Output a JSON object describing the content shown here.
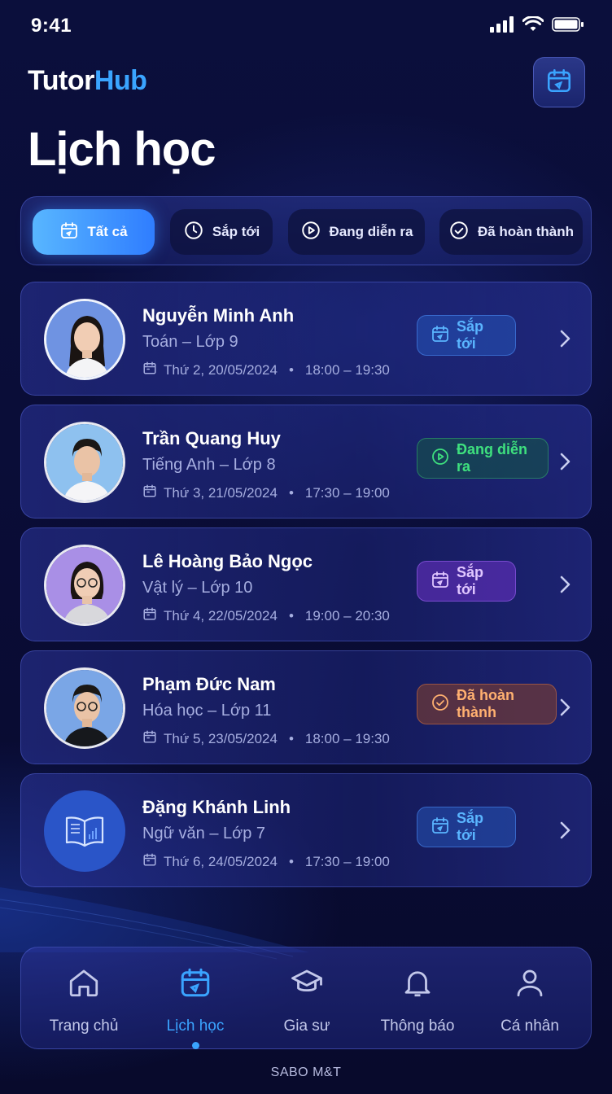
{
  "status_bar": {
    "time": "9:41"
  },
  "header": {
    "brand_part1": "Tutor",
    "brand_part2": "Hub",
    "calendar_button_icon": "calendar-icon"
  },
  "page_title": "Lịch học",
  "filters": [
    {
      "label": "Tất cả",
      "icon": "calendar-icon",
      "active": true
    },
    {
      "label": "Sắp tới",
      "icon": "clock-icon",
      "active": false
    },
    {
      "label": "Đang diễn ra",
      "icon": "play-circle-icon",
      "active": false
    },
    {
      "label": "Đã hoàn thành",
      "icon": "check-circle-icon",
      "active": false
    }
  ],
  "lessons": [
    {
      "name": "Nguyễn Minh Anh",
      "subject": "Toán – Lớp 9",
      "date": "Thứ 2, 20/05/2024",
      "time": "18:00 – 19:30",
      "status": "Sắp tới",
      "status_color": "#5ab5ff"
    },
    {
      "name": "Trần Quang Huy",
      "subject": "Tiếng Anh – Lớp 8",
      "date": "Thứ 3, 21/05/2024",
      "time": "17:30 – 19:00",
      "status": "Đang diễn ra",
      "status_color": "#3ee07e"
    },
    {
      "name": "Lê Hoàng Bảo Ngọc",
      "subject": "Vật lý – Lớp 10",
      "date": "Thứ 4, 22/05/2024",
      "time": "19:00 – 20:30",
      "status": "Sắp tới",
      "status_color": "#e0c6ff"
    },
    {
      "name": "Phạm Đức Nam",
      "subject": "Hóa học – Lớp 11",
      "date": "Thứ 5, 23/05/2024",
      "time": "18:00 – 19:30",
      "status": "Đã hoàn thành",
      "status_color": "#ffb070"
    },
    {
      "name": "Đặng Khánh Linh",
      "subject": "Ngữ văn – Lớp 7",
      "date": "Thứ 6, 24/05/2024",
      "time": "17:30 – 19:00",
      "status": "Sắp tới",
      "status_color": "#5ab5ff"
    }
  ],
  "bottom_nav": [
    {
      "label": "Trang chủ",
      "icon": "home-icon",
      "active": false
    },
    {
      "label": "Lịch học",
      "icon": "calendar-icon",
      "active": true
    },
    {
      "label": "Gia sư",
      "icon": "graduation-cap-icon",
      "active": false
    },
    {
      "label": "Thông báo",
      "icon": "bell-icon",
      "active": false
    },
    {
      "label": "Cá nhân",
      "icon": "user-icon",
      "active": false
    }
  ],
  "footer": "SABO M&T",
  "colors": {
    "accent": "#3aa4ff",
    "background": "#0a0d38"
  }
}
